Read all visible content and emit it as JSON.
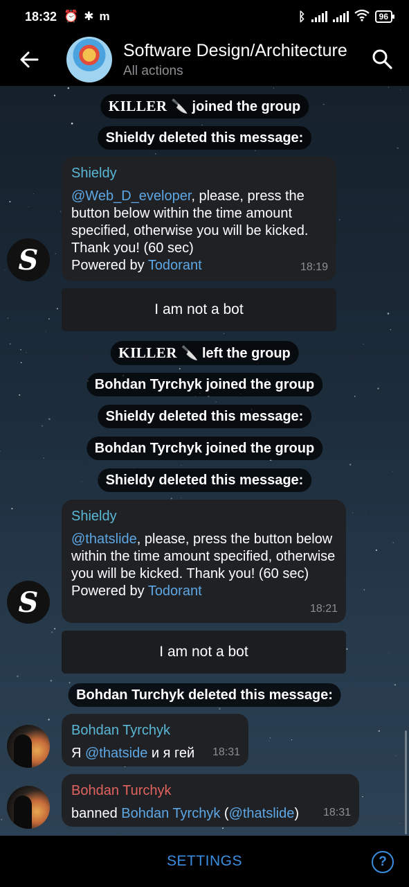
{
  "statusbar": {
    "time": "18:32",
    "notif_icons": [
      "alarm-icon",
      "slack-icon",
      "m-icon"
    ],
    "m_label": "m",
    "battery": "96"
  },
  "header": {
    "title": "Software Design/Architecture",
    "subtitle": "All actions"
  },
  "messages": {
    "svc1": {
      "user": "KILLER",
      "text": "joined the group"
    },
    "svc2": "Shieldy deleted this message:",
    "bubble1": {
      "name": "Shieldy",
      "mention": "@Web_D_eveloper",
      "text": ", please, press the button below within the time amount specified, otherwise you will be kicked. Thank you! (60 sec)",
      "powered": "Powered by ",
      "powered_link": "Todorant",
      "time": "18:19"
    },
    "button1": "I am not a bot",
    "svc3": {
      "user": "KILLER",
      "text": "left the group"
    },
    "svc4": "Bohdan Tyrchyk joined the group",
    "svc5": "Shieldy deleted this message:",
    "svc6": "Bohdan Tyrchyk joined the group",
    "svc7": "Shieldy deleted this message:",
    "bubble2": {
      "name": "Shieldy",
      "mention": "@thatslide",
      "text": ", please, press the button below within the time amount specified, otherwise you will be kicked. Thank you! (60 sec)",
      "powered": "Powered by ",
      "powered_link": "Todorant",
      "time": "18:21"
    },
    "button2": "I am not a bot",
    "svc8": "Bohdan Turchyk deleted this message:",
    "bubble3": {
      "name": "Bohdan Tyrchyk",
      "prefix": "Я ",
      "mention": "@thatside",
      "suffix": " и я гей",
      "time": "18:31"
    },
    "bubble4": {
      "name": "Bohdan Turchyk",
      "prefix": "banned ",
      "user_link": "Bohdan Tyrchyk",
      "open": " (",
      "mention": "@thatslide",
      "close": ")",
      "time": "18:31"
    }
  },
  "avatar_letter": "S",
  "bottom": {
    "settings": "SETTINGS",
    "help": "?"
  },
  "colors": {
    "accent": "#3a8ee0",
    "link": "#5ea7e5",
    "name_cyan": "#5ab7d6",
    "name_red": "#e2625e",
    "bubble": "#1f2124"
  }
}
